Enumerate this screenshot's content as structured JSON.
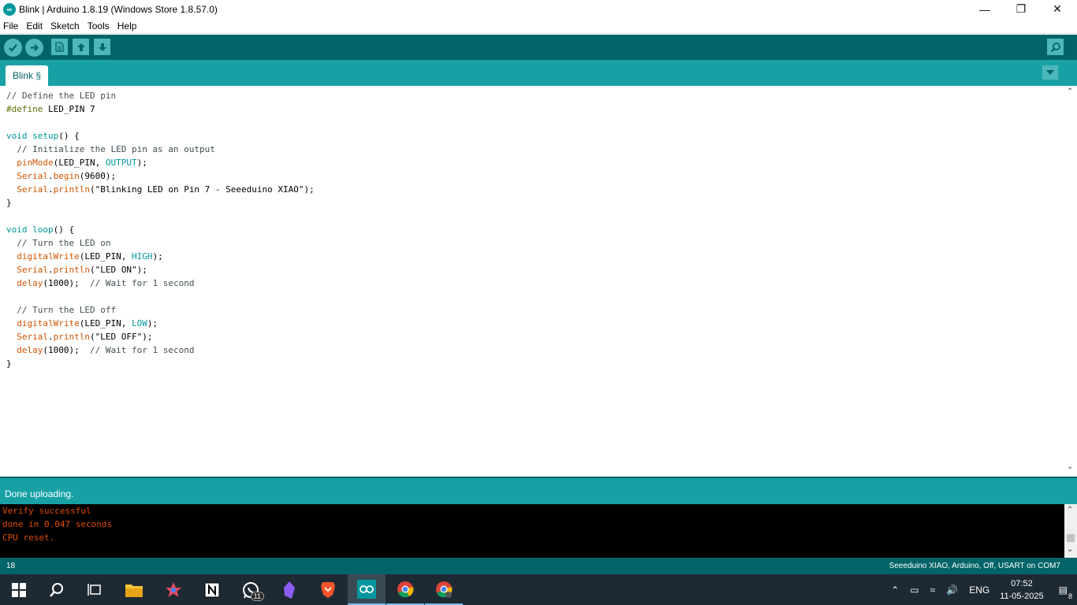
{
  "window": {
    "title": "Blink | Arduino 1.8.19 (Windows Store 1.8.57.0)",
    "logo": "∞",
    "minimize": "—",
    "restore": "❐",
    "close": "✕"
  },
  "menu": {
    "file": "File",
    "edit": "Edit",
    "sketch": "Sketch",
    "tools": "Tools",
    "help": "Help"
  },
  "toolbar": {
    "buttons": [
      "verify-icon",
      "upload-icon",
      "new-icon",
      "open-icon",
      "save-icon",
      "serial-monitor-icon"
    ]
  },
  "tabs": {
    "active": "Blink §"
  },
  "editor": {
    "lines": [
      "// Define the LED pin",
      "#define LED_PIN 7",
      "",
      "void setup() {",
      "  // Initialize the LED pin as an output",
      "  pinMode(LED_PIN, OUTPUT);",
      "  Serial.begin(9600);",
      "  Serial.println(\"Blinking LED on Pin 7 - Seeeduino XIAO\");",
      "}",
      "",
      "void loop() {",
      "  // Turn the LED on",
      "  digitalWrite(LED_PIN, HIGH);",
      "  Serial.println(\"LED ON\");",
      "  delay(1000);  // Wait for 1 second",
      "",
      "  // Turn the LED off",
      "  digitalWrite(LED_PIN, LOW);",
      "  Serial.println(\"LED OFF\");",
      "  delay(1000);  // Wait for 1 second",
      "}"
    ]
  },
  "status": {
    "message": "Done uploading."
  },
  "console": {
    "lines": [
      "Verify successful",
      "done in 0.047 seconds",
      "CPU reset."
    ]
  },
  "footer": {
    "line_number": "18",
    "board": "Seeeduino XIAO, Arduino, Off, USART on COM7"
  },
  "taskbar": {
    "whatsapp_badge": "11",
    "tray_language": "ENG",
    "time": "07:52",
    "date": "11-05-2025",
    "notifications": "8"
  },
  "colors": {
    "toolbar": "#006468",
    "tabstrip": "#17a1a5",
    "keyword": "#00979c",
    "function": "#d35400",
    "console_text": "#e34c00"
  }
}
